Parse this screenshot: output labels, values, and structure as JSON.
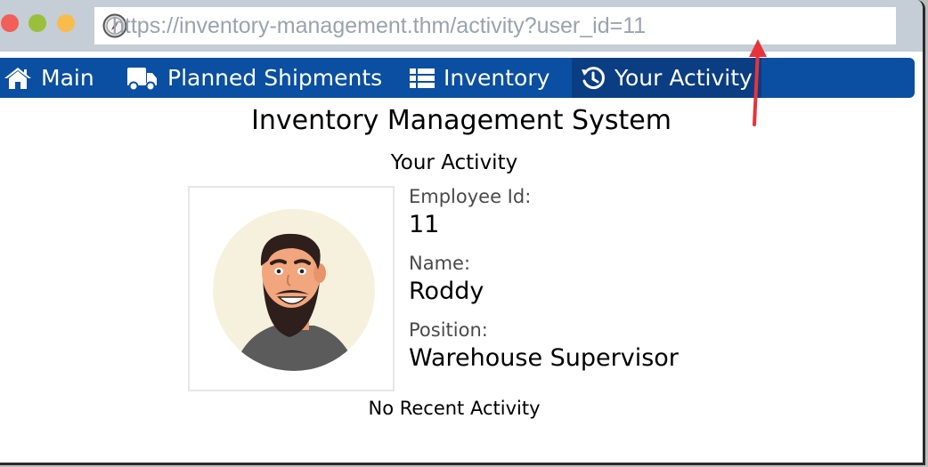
{
  "browser": {
    "url": "https://inventory-management.thm/activity?user_id=11"
  },
  "nav": {
    "items": [
      {
        "label": "Main",
        "icon": "home-icon"
      },
      {
        "label": "Planned Shipments",
        "icon": "truck-icon"
      },
      {
        "label": "Inventory",
        "icon": "list-icon"
      },
      {
        "label": "Your Activity",
        "icon": "history-icon",
        "active": true
      }
    ]
  },
  "page": {
    "title": "Inventory Management System",
    "subtitle": "Your Activity"
  },
  "profile": {
    "employee_id_label": "Employee Id:",
    "employee_id": "11",
    "name_label": "Name:",
    "name": "Roddy",
    "position_label": "Position:",
    "position": "Warehouse Supervisor"
  },
  "activity": {
    "empty_message": "No Recent Activity"
  },
  "colors": {
    "navbar": "#0a4fa1",
    "navbar_active": "#0b3d82",
    "titlebar": "#c5cdd6",
    "annotation_arrow": "#e8333a"
  }
}
